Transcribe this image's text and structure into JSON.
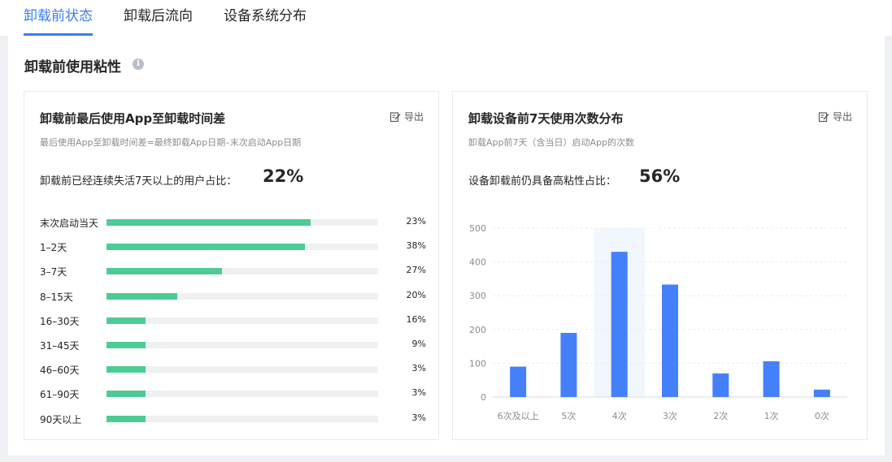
{
  "tabs": [
    {
      "label": "卸载前状态",
      "active": true
    },
    {
      "label": "卸载后流向",
      "active": false
    },
    {
      "label": "设备系统分布",
      "active": false
    }
  ],
  "section": {
    "title": "卸载前使用粘性",
    "info_icon": "info-circle-icon"
  },
  "left_card": {
    "title": "卸载前最后使用App至卸载时间差",
    "export_label": "导出",
    "export_icon": "edit-export-icon",
    "subtitle": "最后使用App至卸载时间差=最终卸载App日期–末次启动App日期",
    "kpi_label": "卸载前已经连续失活7天以上的用户占比：",
    "kpi_value": "22%",
    "bar_color": "#4ccc94",
    "rows": [
      {
        "label": "末次启动当天",
        "pct_text": "23%",
        "fill": 0.75
      },
      {
        "label": "1–2天",
        "pct_text": "38%",
        "fill": 0.73
      },
      {
        "label": "3–7天",
        "pct_text": "27%",
        "fill": 0.425
      },
      {
        "label": "8–15天",
        "pct_text": "20%",
        "fill": 0.26
      },
      {
        "label": "16–30天",
        "pct_text": "16%",
        "fill": 0.145
      },
      {
        "label": "31–45天",
        "pct_text": "9%",
        "fill": 0.145
      },
      {
        "label": "46–60天",
        "pct_text": "3%",
        "fill": 0.145
      },
      {
        "label": "61–90天",
        "pct_text": "3%",
        "fill": 0.145
      },
      {
        "label": "90天以上",
        "pct_text": "3%",
        "fill": 0.145
      }
    ]
  },
  "right_card": {
    "title": "卸载设备前7天使用次数分布",
    "export_label": "导出",
    "export_icon": "edit-export-icon",
    "subtitle": "卸载App前7天（含当日）启动App的次数",
    "kpi_label": "设备卸载前仍具备高粘性占比：",
    "kpi_value": "56%"
  },
  "chart_data": {
    "type": "bar",
    "categories": [
      "6次及以上",
      "5次",
      "4次",
      "3次",
      "2次",
      "1次",
      "0次"
    ],
    "values": [
      90,
      190,
      430,
      333,
      70,
      106,
      22
    ],
    "ylim": [
      0,
      500
    ],
    "yticks": [
      0,
      100,
      200,
      300,
      400,
      500
    ],
    "grid": true,
    "highlight_category": "4次",
    "bar_color": "#4580fb",
    "highlight_color": "#f1f6ff"
  }
}
